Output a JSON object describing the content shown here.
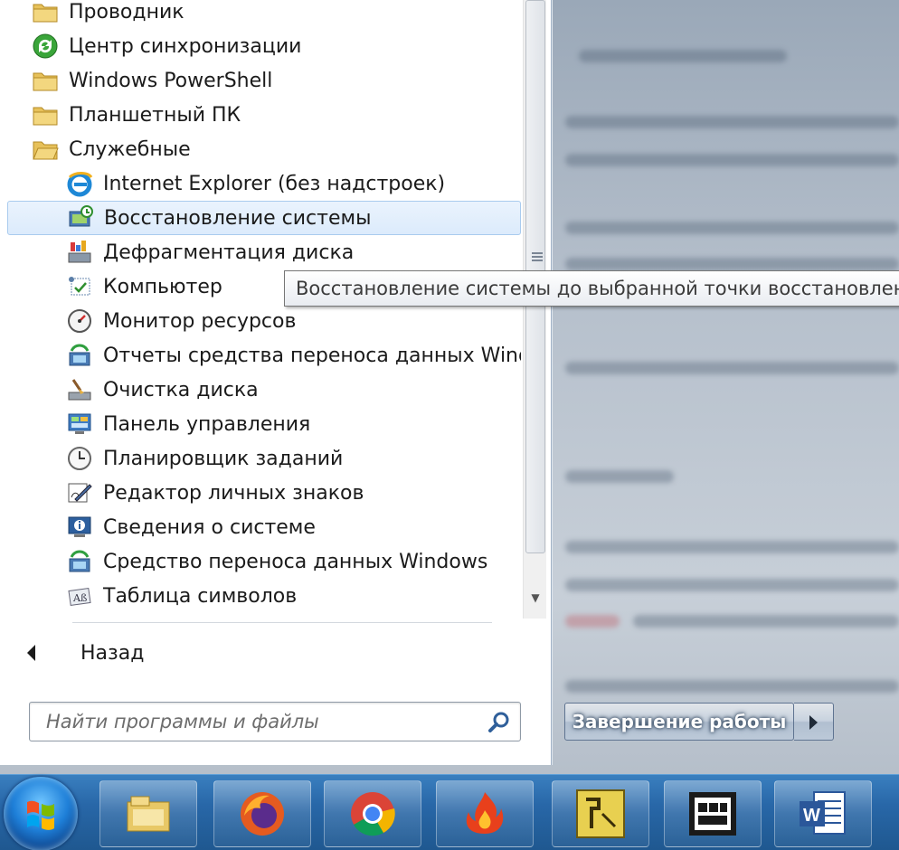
{
  "menu": {
    "items": [
      {
        "label": "Проводник",
        "icon": "folder-icon",
        "kind": "folder"
      },
      {
        "label": "Центр синхронизации",
        "icon": "sync-center-icon",
        "kind": "folder"
      },
      {
        "label": "Windows PowerShell",
        "icon": "folder-icon",
        "kind": "folder"
      },
      {
        "label": "Планшетный ПК",
        "icon": "folder-icon",
        "kind": "folder"
      },
      {
        "label": "Служебные",
        "icon": "folder-icon",
        "kind": "folder"
      },
      {
        "label": "Internet Explorer (без надстроек)",
        "icon": "internet-explorer-icon",
        "kind": "app"
      },
      {
        "label": "Восстановление системы",
        "icon": "system-restore-icon",
        "kind": "app",
        "highlighted": true
      },
      {
        "label": "Дефрагментация диска",
        "icon": "defragment-icon",
        "kind": "app"
      },
      {
        "label": "Компьютер",
        "icon": "computer-icon",
        "kind": "app"
      },
      {
        "label": "Монитор ресурсов",
        "icon": "resource-monitor-icon",
        "kind": "app"
      },
      {
        "label": "Отчеты средства переноса данных Windows",
        "icon": "transfer-reports-icon",
        "kind": "app"
      },
      {
        "label": "Очистка диска",
        "icon": "disk-cleanup-icon",
        "kind": "app"
      },
      {
        "label": "Панель управления",
        "icon": "control-panel-icon",
        "kind": "app"
      },
      {
        "label": "Планировщик заданий",
        "icon": "task-scheduler-icon",
        "kind": "app"
      },
      {
        "label": "Редактор личных знаков",
        "icon": "character-editor-icon",
        "kind": "app"
      },
      {
        "label": "Сведения о системе",
        "icon": "system-info-icon",
        "kind": "app"
      },
      {
        "label": "Средство переноса данных Windows",
        "icon": "easy-transfer-icon",
        "kind": "app"
      },
      {
        "label": "Таблица символов",
        "icon": "character-map-icon",
        "kind": "app"
      }
    ],
    "back_label": "Назад",
    "search_placeholder": "Найти программы и файлы"
  },
  "tooltip": "Восстановление системы до выбранной точки восстановлен",
  "shutdown_label": "Завершение работы",
  "taskbar": {
    "buttons": [
      {
        "name": "explorer-taskbar-button",
        "icon": "explorer-icon"
      },
      {
        "name": "firefox-taskbar-button",
        "icon": "firefox-icon"
      },
      {
        "name": "chrome-taskbar-button",
        "icon": "chrome-icon"
      },
      {
        "name": "burning-app-taskbar-button",
        "icon": "flame-icon"
      },
      {
        "name": "yellow-app-taskbar-button",
        "icon": "app-icon"
      },
      {
        "name": "video-taskbar-button",
        "icon": "film-icon"
      },
      {
        "name": "word-taskbar-button",
        "icon": "word-icon"
      }
    ]
  },
  "colors": {
    "highlight_bg": "#dcebfc",
    "highlight_border": "#a9cbee",
    "taskbar": "#2867a8"
  }
}
